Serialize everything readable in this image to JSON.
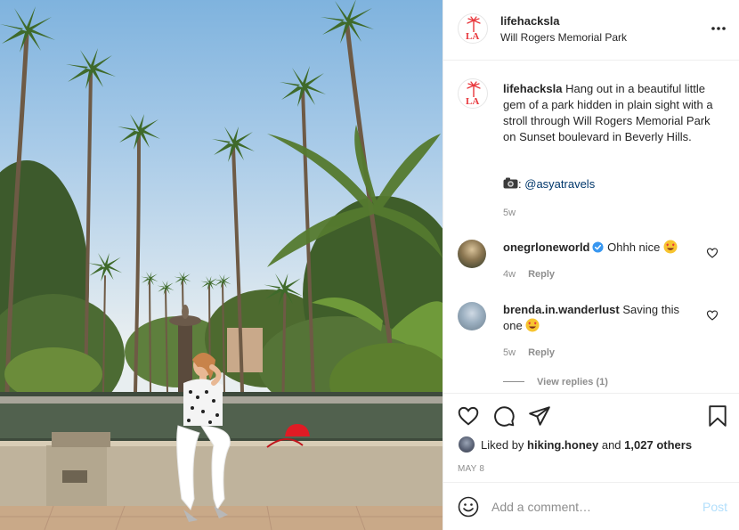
{
  "post": {
    "username": "lifehacksla",
    "location": "Will Rogers Memorial Park",
    "caption": "Hang out in a beautiful little gem of a park hidden in plain sight with a stroll through Will Rogers Memorial Park on Sunset boulevard in Beverly Hills.",
    "credit_sep": ":",
    "credit_handle": "@asyatravels",
    "caption_time": "5w"
  },
  "comments": [
    {
      "username": "onegrloneworld",
      "text": "Ohhh nice",
      "time": "4w",
      "reply": "Reply",
      "verified": true
    },
    {
      "username": "brenda.in.wanderlust",
      "text": "Saving this one",
      "time": "5w",
      "reply": "Reply",
      "verified": false
    }
  ],
  "view_replies": "View replies (1)",
  "likes": {
    "prefix": "Liked by",
    "user": "hiking.honey",
    "middle": "and",
    "count": "1,027 others"
  },
  "date": "MAY 8",
  "comment_box": {
    "placeholder": "Add a comment…",
    "post_label": "Post"
  },
  "icons": [
    "more-icon",
    "heart-icon",
    "comment-icon",
    "share-icon",
    "bookmark-icon",
    "smiley-icon",
    "camera-emoji",
    "heart-eyes-emoji",
    "verified-icon"
  ],
  "colors": {
    "link": "#00376b",
    "post_disabled": "#b2dffc",
    "muted": "#8e8e8e",
    "verified": "#3897f0",
    "avatar_logo": "#e8383d"
  }
}
